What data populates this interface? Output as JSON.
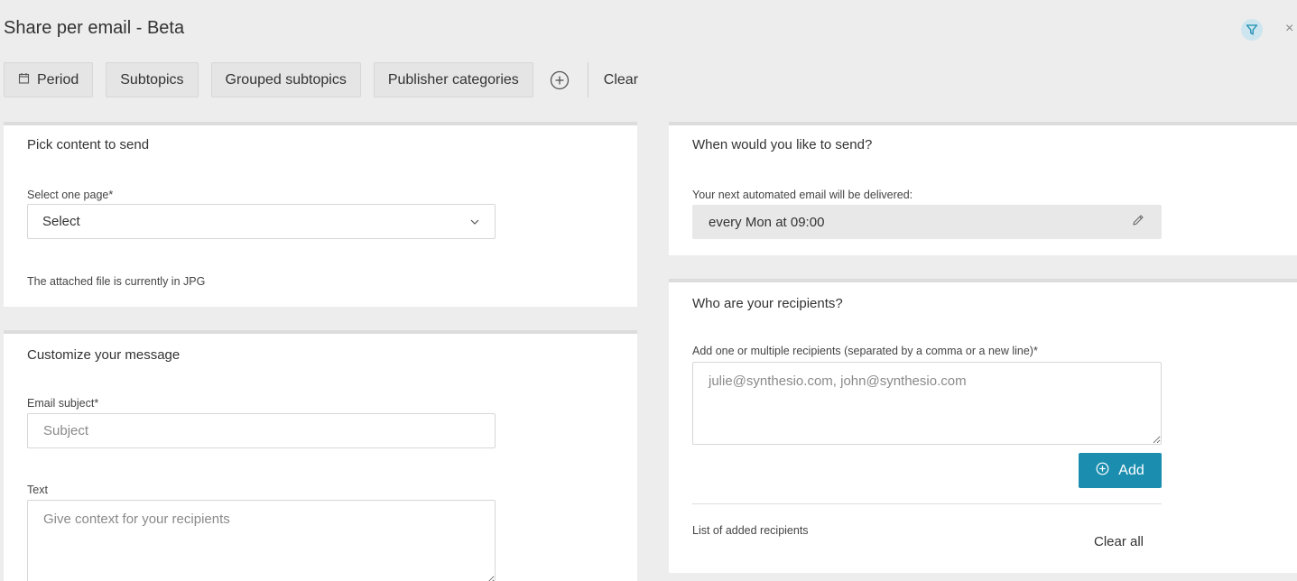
{
  "header": {
    "title": "Share per email - Beta",
    "close_symbol": "×",
    "filter_icon": "filter-icon",
    "accent_color": "#1b8eb0"
  },
  "toolbar": {
    "period_label": "Period",
    "subtopics_label": "Subtopics",
    "grouped_subtopics_label": "Grouped subtopics",
    "publisher_categories_label": "Publisher categories",
    "clear_label": "Clear"
  },
  "content_panel": {
    "title": "Pick content to send",
    "page_label": "Select one page*",
    "page_value": "Select",
    "file_note": "The attached file is currently in JPG"
  },
  "message_panel": {
    "title": "Customize your message",
    "subject_label": "Email subject*",
    "subject_placeholder": "Subject",
    "text_label": "Text",
    "text_placeholder": "Give context for your recipients"
  },
  "schedule_panel": {
    "title": "When would you like to send?",
    "delivery_label": "Your next automated email will be delivered:",
    "delivery_value": "every Mon at 09:00"
  },
  "recipients_panel": {
    "title": "Who are your recipients?",
    "recipients_label": "Add one or multiple recipients (separated by a comma or a new line)*",
    "recipients_placeholder": "julie@synthesio.com, john@synthesio.com",
    "add_label": "Add",
    "list_label": "List of added recipients",
    "clear_all_label": "Clear all"
  }
}
